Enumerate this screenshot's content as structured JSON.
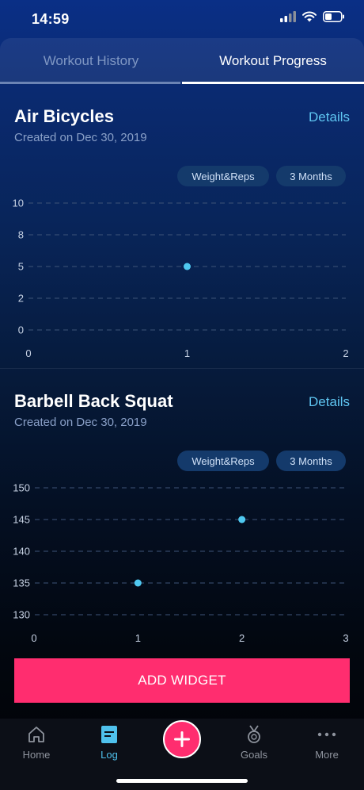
{
  "status_bar": {
    "time": "14:59"
  },
  "tabs": [
    {
      "label": "Workout History",
      "active": false
    },
    {
      "label": "Workout Progress",
      "active": true
    }
  ],
  "widgets": [
    {
      "title": "Air Bicycles",
      "created": "Created on Dec 30, 2019",
      "details_label": "Details",
      "filter_metric": "Weight&Reps",
      "filter_range": "3 Months"
    },
    {
      "title": "Barbell Back Squat",
      "created": "Created on Dec 30, 2019",
      "details_label": "Details",
      "filter_metric": "Weight&Reps",
      "filter_range": "3 Months"
    }
  ],
  "chart_data": [
    {
      "type": "scatter",
      "title": "Air Bicycles",
      "x_ticks": [
        "0",
        "1",
        "2"
      ],
      "y_ticks": [
        "10",
        "8",
        "5",
        "2",
        "0"
      ],
      "y_tick_values": [
        10,
        8,
        5,
        2,
        0
      ],
      "xlim": [
        0,
        2
      ],
      "points": [
        {
          "x": 1,
          "y": 5
        }
      ],
      "grid": true,
      "color": "#4fc8f0"
    },
    {
      "type": "scatter",
      "title": "Barbell Back Squat",
      "x_ticks": [
        "0",
        "1",
        "2",
        "3"
      ],
      "y_ticks": [
        "150",
        "145",
        "140",
        "135",
        "130"
      ],
      "y_tick_values": [
        150,
        145,
        140,
        135,
        130
      ],
      "xlim": [
        0,
        3
      ],
      "points": [
        {
          "x": 1,
          "y": 135
        },
        {
          "x": 2,
          "y": 145
        }
      ],
      "grid": true,
      "color": "#4fc8f0"
    }
  ],
  "actions": {
    "add_widget": "ADD WIDGET"
  },
  "tabbar": {
    "items": [
      {
        "label": "Home",
        "icon": "home-icon",
        "active": false
      },
      {
        "label": "Log",
        "icon": "log-icon",
        "active": true
      },
      {
        "label": "",
        "icon": "plus-icon",
        "active": false
      },
      {
        "label": "Goals",
        "icon": "medal-icon",
        "active": false
      },
      {
        "label": "More",
        "icon": "more-icon",
        "active": false
      }
    ]
  },
  "colors": {
    "accent": "#ff2d6f",
    "link": "#5fc6f2",
    "point": "#4fc8f0"
  }
}
